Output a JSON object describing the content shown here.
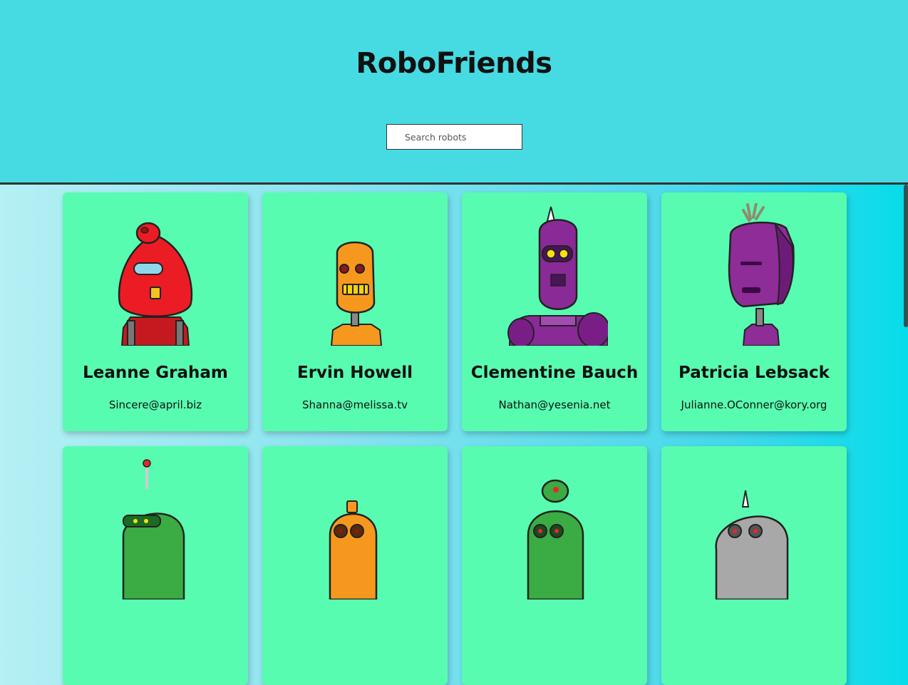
{
  "app": {
    "title": "RoboFriends"
  },
  "search": {
    "placeholder": "Search robots",
    "value": ""
  },
  "robots": [
    {
      "name": "Leanne Graham",
      "email": "Sincere@april.biz",
      "icon": "red-robot-icon",
      "color": "#e8262b"
    },
    {
      "name": "Ervin Howell",
      "email": "Shanna@melissa.tv",
      "icon": "orange-robot-icon",
      "color": "#f7981e"
    },
    {
      "name": "Clementine Bauch",
      "email": "Nathan@yesenia.net",
      "icon": "purple-robot-icon",
      "color": "#8a2a96"
    },
    {
      "name": "Patricia Lebsack",
      "email": "Julianne.OConner@kory.org",
      "icon": "purple-robot-icon",
      "color": "#8e2c98"
    },
    {
      "name": "",
      "email": "",
      "icon": "green-robot-icon",
      "color": "#3bab43"
    },
    {
      "name": "",
      "email": "",
      "icon": "orange-robot-icon",
      "color": "#f7981e"
    },
    {
      "name": "",
      "email": "",
      "icon": "green-robot-icon",
      "color": "#3bab43"
    },
    {
      "name": "",
      "email": "",
      "icon": "gray-robot-icon",
      "color": "#a8a8a8"
    }
  ]
}
